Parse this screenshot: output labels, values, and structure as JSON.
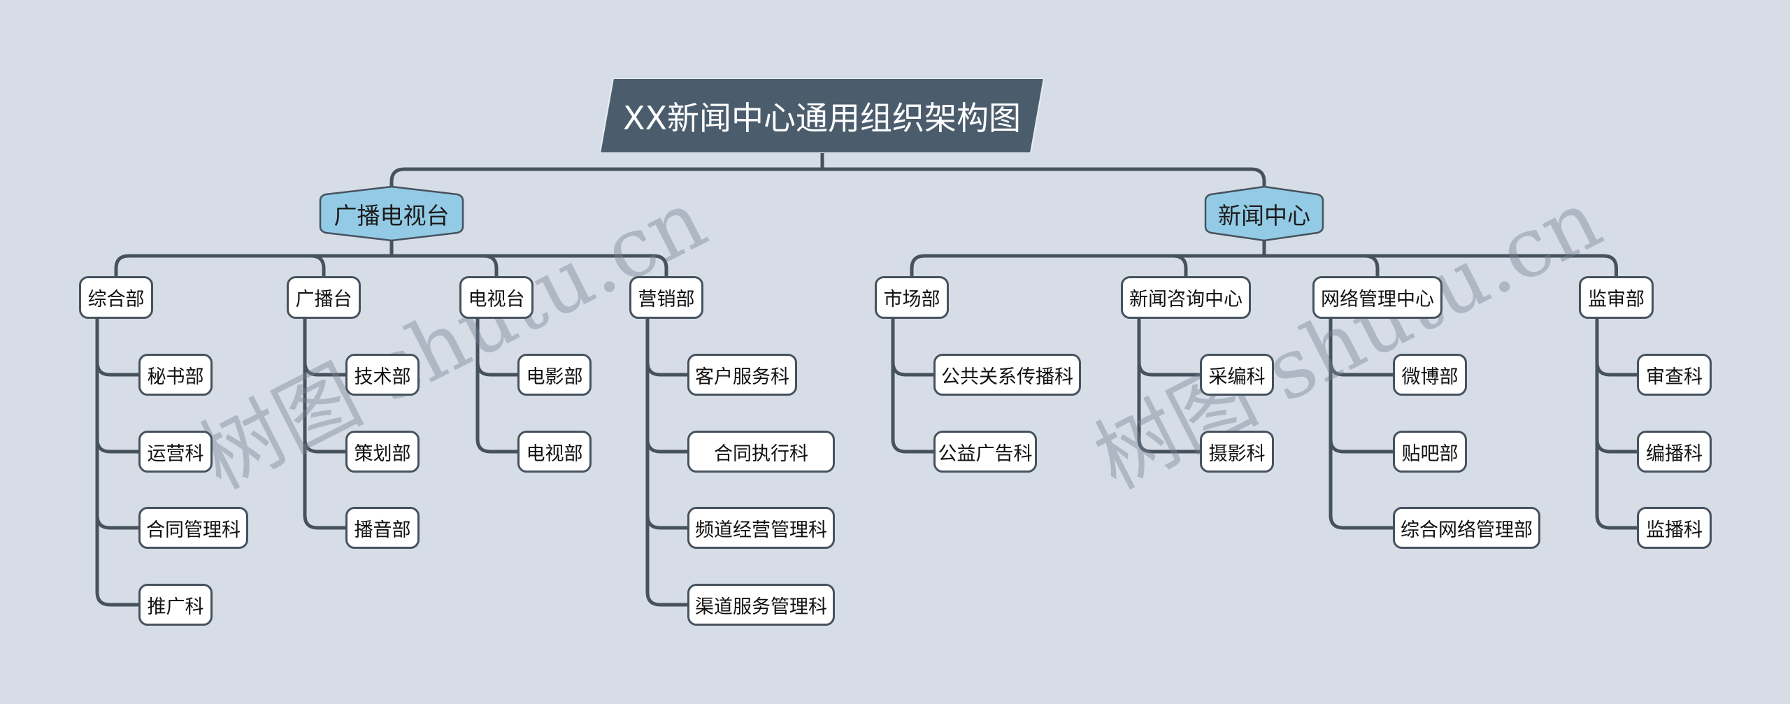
{
  "title": "XX新闻中心通用组织架构图",
  "colors": {
    "background": "#d6dde7",
    "title_fill": "#4b5d6d",
    "branch_fill": "#93cbe6",
    "line": "#46525e",
    "node_fill": "#ffffff"
  },
  "watermark": "树图 shutu.cn",
  "tree": [
    {
      "label": "广播电视台",
      "children": [
        {
          "label": "综合部",
          "children": [
            "秘书部",
            "运营科",
            "合同管理科",
            "推广科"
          ]
        },
        {
          "label": "广播台",
          "children": [
            "技术部",
            "策划部",
            "播音部"
          ]
        },
        {
          "label": "电视台",
          "children": [
            "电影部",
            "电视部"
          ]
        },
        {
          "label": "营销部",
          "children": [
            "客户服务科",
            "合同执行科",
            "频道经营管理科",
            "渠道服务管理科"
          ]
        }
      ]
    },
    {
      "label": "新闻中心",
      "children": [
        {
          "label": "市场部",
          "children": [
            "公共关系传播科",
            "公益广告科"
          ]
        },
        {
          "label": "新闻咨询中心",
          "children": [
            "采编科",
            "摄影科"
          ]
        },
        {
          "label": "网络管理中心",
          "children": [
            "微博部",
            "贴吧部",
            "综合网络管理部"
          ]
        },
        {
          "label": "监审部",
          "children": [
            "审查科",
            "编播科",
            "监播科"
          ]
        }
      ]
    }
  ]
}
